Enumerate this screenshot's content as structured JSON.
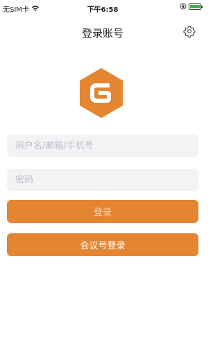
{
  "status_bar": {
    "carrier": "无SIM卡",
    "time": "下午6:58"
  },
  "nav": {
    "title": "登录账号"
  },
  "form": {
    "username_placeholder": "用户名/邮箱/手机号",
    "password_placeholder": "密码",
    "login_label": "登录",
    "meeting_login_label": "会议号登录"
  },
  "colors": {
    "accent": "#e48532",
    "field_bg": "#f2f3f5"
  },
  "icons": [
    "wifi-icon",
    "lock-rotation-icon",
    "battery-icon",
    "settings-icon",
    "app-logo"
  ]
}
